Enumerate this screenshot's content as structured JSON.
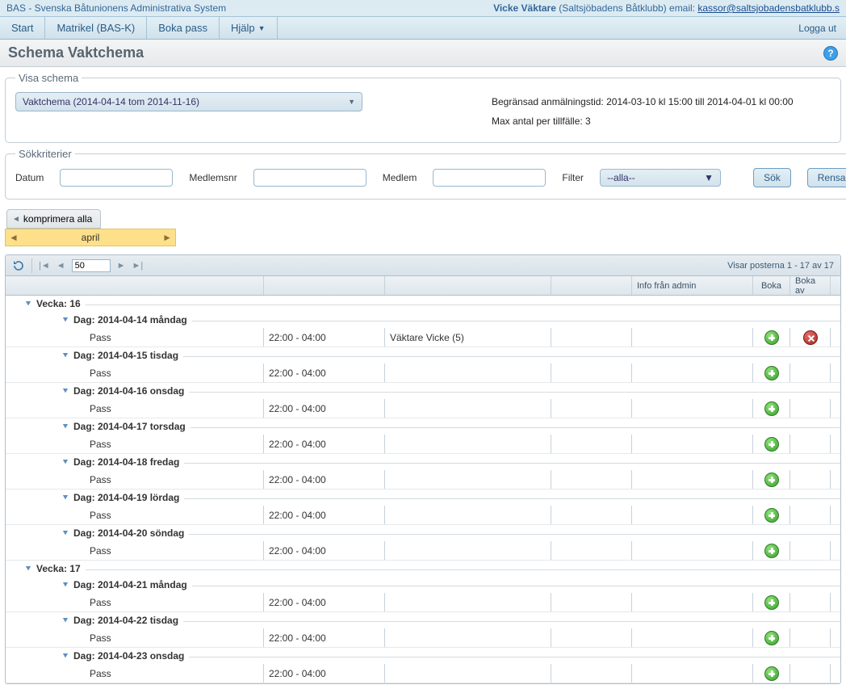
{
  "topbar": {
    "app_title": "BAS - Svenska Båtunionens Administrativa System",
    "user_name": "Vicke Väktare",
    "club": "Saltsjöbadens Båtklubb",
    "email_label": "email:",
    "email": "kassor@saltsjobadensbatklubb.s"
  },
  "menu": {
    "items": [
      {
        "label": "Start",
        "has_dropdown": false
      },
      {
        "label": "Matrikel (BAS-K)",
        "has_dropdown": false
      },
      {
        "label": "Boka pass",
        "has_dropdown": false
      },
      {
        "label": "Hjälp",
        "has_dropdown": true
      }
    ],
    "logout": "Logga ut"
  },
  "page": {
    "title": "Schema Vaktchema",
    "help": "?"
  },
  "show_panel": {
    "legend": "Visa schema",
    "dropdown_value": "Vaktchema (2014-04-14 tom 2014-11-16)",
    "info_line1": "Begränsad anmälningstid: 2014-03-10 kl 15:00 till 2014-04-01 kl 00:00",
    "info_line2": "Max antal per tillfälle: 3"
  },
  "search_panel": {
    "legend": "Sökkriterier",
    "label_datum": "Datum",
    "label_medlemsnr": "Medlemsnr",
    "label_medlem": "Medlem",
    "label_filter": "Filter",
    "filter_value": "--alla--",
    "btn_search": "Sök",
    "btn_clear": "Rensa"
  },
  "compress_btn": "komprimera alla",
  "month_strip": {
    "label": "april"
  },
  "grid": {
    "page_size": "50",
    "status_text": "Visar posterna 1 - 17 av 17",
    "headers": {
      "admin": "Info från admin",
      "boka": "Boka",
      "bokaav": "Boka av"
    },
    "weeks": [
      {
        "label": "Vecka: 16",
        "days": [
          {
            "label": "Dag: 2014-04-14 måndag",
            "pass_label": "Pass",
            "time": "22:00 - 04:00",
            "member": "Väktare Vicke (5)",
            "has_delete": true
          },
          {
            "label": "Dag: 2014-04-15 tisdag",
            "pass_label": "Pass",
            "time": "22:00 - 04:00",
            "member": "",
            "has_delete": false
          },
          {
            "label": "Dag: 2014-04-16 onsdag",
            "pass_label": "Pass",
            "time": "22:00 - 04:00",
            "member": "",
            "has_delete": false
          },
          {
            "label": "Dag: 2014-04-17 torsdag",
            "pass_label": "Pass",
            "time": "22:00 - 04:00",
            "member": "",
            "has_delete": false
          },
          {
            "label": "Dag: 2014-04-18 fredag",
            "pass_label": "Pass",
            "time": "22:00 - 04:00",
            "member": "",
            "has_delete": false
          },
          {
            "label": "Dag: 2014-04-19 lördag",
            "pass_label": "Pass",
            "time": "22:00 - 04:00",
            "member": "",
            "has_delete": false
          },
          {
            "label": "Dag: 2014-04-20 söndag",
            "pass_label": "Pass",
            "time": "22:00 - 04:00",
            "member": "",
            "has_delete": false
          }
        ]
      },
      {
        "label": "Vecka: 17",
        "days": [
          {
            "label": "Dag: 2014-04-21 måndag",
            "pass_label": "Pass",
            "time": "22:00 - 04:00",
            "member": "",
            "has_delete": false
          },
          {
            "label": "Dag: 2014-04-22 tisdag",
            "pass_label": "Pass",
            "time": "22:00 - 04:00",
            "member": "",
            "has_delete": false
          },
          {
            "label": "Dag: 2014-04-23 onsdag",
            "pass_label": "Pass",
            "time": "22:00 - 04:00",
            "member": "",
            "has_delete": false
          }
        ]
      }
    ]
  }
}
